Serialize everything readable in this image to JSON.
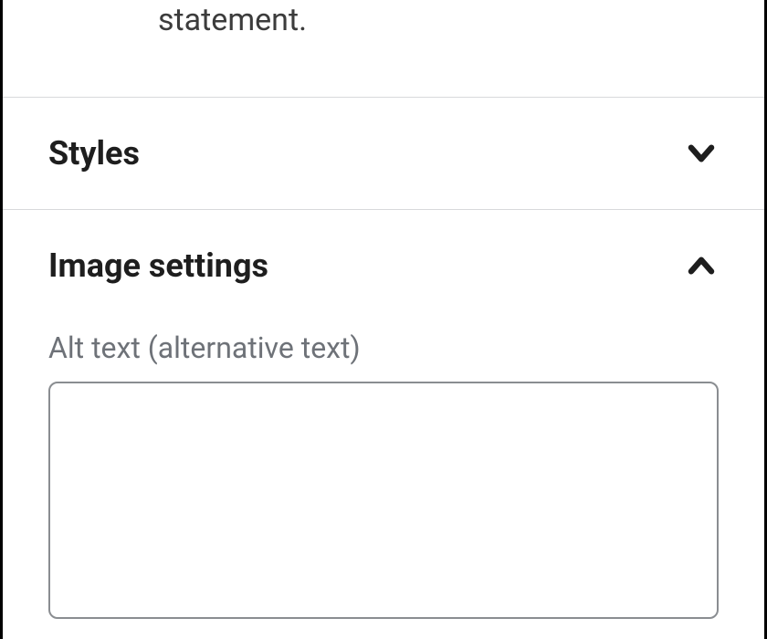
{
  "top_description_fragment": "statement.",
  "sections": {
    "styles": {
      "title": "Styles",
      "expanded": false
    },
    "image_settings": {
      "title": "Image settings",
      "expanded": true,
      "alt_text": {
        "label": "Alt text (alternative text)",
        "value": ""
      }
    }
  }
}
